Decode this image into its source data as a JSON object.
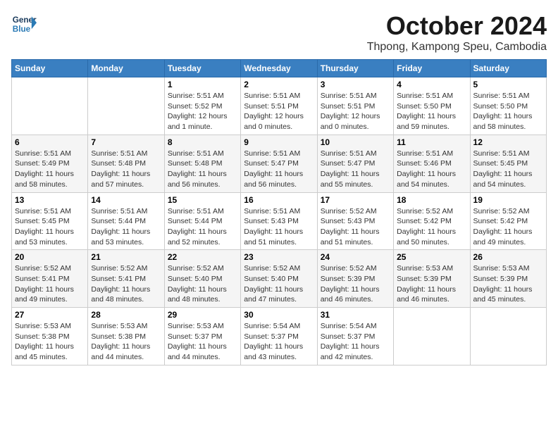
{
  "header": {
    "logo_line1": "General",
    "logo_line2": "Blue",
    "month": "October 2024",
    "location": "Thpong, Kampong Speu, Cambodia"
  },
  "days_of_week": [
    "Sunday",
    "Monday",
    "Tuesday",
    "Wednesday",
    "Thursday",
    "Friday",
    "Saturday"
  ],
  "weeks": [
    [
      {
        "day": "",
        "info": ""
      },
      {
        "day": "",
        "info": ""
      },
      {
        "day": "1",
        "info": "Sunrise: 5:51 AM\nSunset: 5:52 PM\nDaylight: 12 hours\nand 1 minute."
      },
      {
        "day": "2",
        "info": "Sunrise: 5:51 AM\nSunset: 5:51 PM\nDaylight: 12 hours\nand 0 minutes."
      },
      {
        "day": "3",
        "info": "Sunrise: 5:51 AM\nSunset: 5:51 PM\nDaylight: 12 hours\nand 0 minutes."
      },
      {
        "day": "4",
        "info": "Sunrise: 5:51 AM\nSunset: 5:50 PM\nDaylight: 11 hours\nand 59 minutes."
      },
      {
        "day": "5",
        "info": "Sunrise: 5:51 AM\nSunset: 5:50 PM\nDaylight: 11 hours\nand 58 minutes."
      }
    ],
    [
      {
        "day": "6",
        "info": "Sunrise: 5:51 AM\nSunset: 5:49 PM\nDaylight: 11 hours\nand 58 minutes."
      },
      {
        "day": "7",
        "info": "Sunrise: 5:51 AM\nSunset: 5:48 PM\nDaylight: 11 hours\nand 57 minutes."
      },
      {
        "day": "8",
        "info": "Sunrise: 5:51 AM\nSunset: 5:48 PM\nDaylight: 11 hours\nand 56 minutes."
      },
      {
        "day": "9",
        "info": "Sunrise: 5:51 AM\nSunset: 5:47 PM\nDaylight: 11 hours\nand 56 minutes."
      },
      {
        "day": "10",
        "info": "Sunrise: 5:51 AM\nSunset: 5:47 PM\nDaylight: 11 hours\nand 55 minutes."
      },
      {
        "day": "11",
        "info": "Sunrise: 5:51 AM\nSunset: 5:46 PM\nDaylight: 11 hours\nand 54 minutes."
      },
      {
        "day": "12",
        "info": "Sunrise: 5:51 AM\nSunset: 5:45 PM\nDaylight: 11 hours\nand 54 minutes."
      }
    ],
    [
      {
        "day": "13",
        "info": "Sunrise: 5:51 AM\nSunset: 5:45 PM\nDaylight: 11 hours\nand 53 minutes."
      },
      {
        "day": "14",
        "info": "Sunrise: 5:51 AM\nSunset: 5:44 PM\nDaylight: 11 hours\nand 53 minutes."
      },
      {
        "day": "15",
        "info": "Sunrise: 5:51 AM\nSunset: 5:44 PM\nDaylight: 11 hours\nand 52 minutes."
      },
      {
        "day": "16",
        "info": "Sunrise: 5:51 AM\nSunset: 5:43 PM\nDaylight: 11 hours\nand 51 minutes."
      },
      {
        "day": "17",
        "info": "Sunrise: 5:52 AM\nSunset: 5:43 PM\nDaylight: 11 hours\nand 51 minutes."
      },
      {
        "day": "18",
        "info": "Sunrise: 5:52 AM\nSunset: 5:42 PM\nDaylight: 11 hours\nand 50 minutes."
      },
      {
        "day": "19",
        "info": "Sunrise: 5:52 AM\nSunset: 5:42 PM\nDaylight: 11 hours\nand 49 minutes."
      }
    ],
    [
      {
        "day": "20",
        "info": "Sunrise: 5:52 AM\nSunset: 5:41 PM\nDaylight: 11 hours\nand 49 minutes."
      },
      {
        "day": "21",
        "info": "Sunrise: 5:52 AM\nSunset: 5:41 PM\nDaylight: 11 hours\nand 48 minutes."
      },
      {
        "day": "22",
        "info": "Sunrise: 5:52 AM\nSunset: 5:40 PM\nDaylight: 11 hours\nand 48 minutes."
      },
      {
        "day": "23",
        "info": "Sunrise: 5:52 AM\nSunset: 5:40 PM\nDaylight: 11 hours\nand 47 minutes."
      },
      {
        "day": "24",
        "info": "Sunrise: 5:52 AM\nSunset: 5:39 PM\nDaylight: 11 hours\nand 46 minutes."
      },
      {
        "day": "25",
        "info": "Sunrise: 5:53 AM\nSunset: 5:39 PM\nDaylight: 11 hours\nand 46 minutes."
      },
      {
        "day": "26",
        "info": "Sunrise: 5:53 AM\nSunset: 5:39 PM\nDaylight: 11 hours\nand 45 minutes."
      }
    ],
    [
      {
        "day": "27",
        "info": "Sunrise: 5:53 AM\nSunset: 5:38 PM\nDaylight: 11 hours\nand 45 minutes."
      },
      {
        "day": "28",
        "info": "Sunrise: 5:53 AM\nSunset: 5:38 PM\nDaylight: 11 hours\nand 44 minutes."
      },
      {
        "day": "29",
        "info": "Sunrise: 5:53 AM\nSunset: 5:37 PM\nDaylight: 11 hours\nand 44 minutes."
      },
      {
        "day": "30",
        "info": "Sunrise: 5:54 AM\nSunset: 5:37 PM\nDaylight: 11 hours\nand 43 minutes."
      },
      {
        "day": "31",
        "info": "Sunrise: 5:54 AM\nSunset: 5:37 PM\nDaylight: 11 hours\nand 42 minutes."
      },
      {
        "day": "",
        "info": ""
      },
      {
        "day": "",
        "info": ""
      }
    ]
  ]
}
